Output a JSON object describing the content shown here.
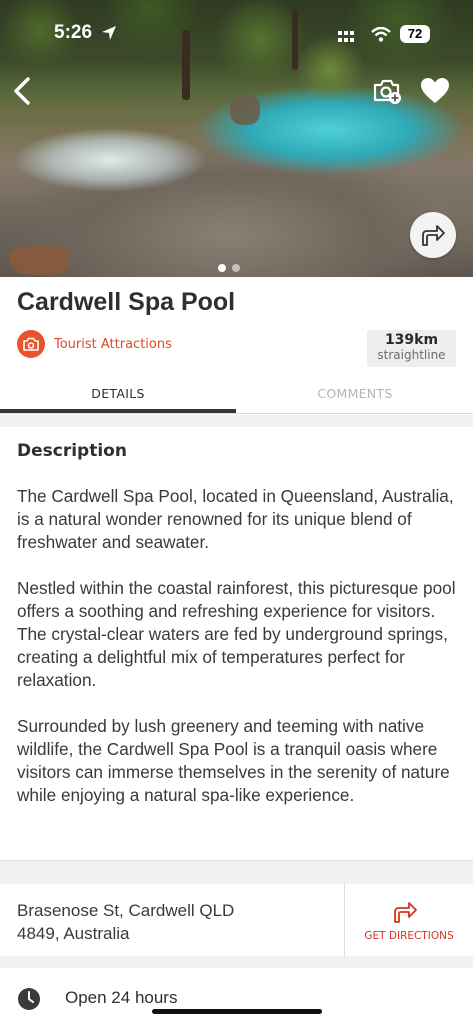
{
  "status_bar": {
    "time": "5:26",
    "battery": "72"
  },
  "place": {
    "name": "Cardwell Spa Pool",
    "category": "Tourist Attractions",
    "distance_value": "139km",
    "distance_label": "straightline"
  },
  "tabs": [
    {
      "label": "DETAILS",
      "active": true
    },
    {
      "label": "COMMENTS",
      "active": false
    }
  ],
  "gallery": {
    "total": 2,
    "current": 1
  },
  "description": {
    "heading": "Description",
    "paragraphs": [
      "The Cardwell Spa Pool, located in Queensland, Australia, is a natural wonder renowned for its unique blend of freshwater and seawater.",
      "Nestled within the coastal rainforest, this picturesque pool offers a soothing and refreshing experience for visitors. The crystal-clear waters are fed by underground springs, creating a delightful mix of temperatures perfect for relaxation.",
      "Surrounded by lush greenery and teeming with native wildlife, the Cardwell Spa Pool is a tranquil oasis where visitors can immerse themselves in the serenity of nature while enjoying a natural spa-like experience."
    ]
  },
  "address": {
    "line1": "Brasenose St, Cardwell QLD",
    "line2": "4849, Australia",
    "directions_label": "GET DIRECTIONS"
  },
  "hours": {
    "label": "Open 24 hours"
  },
  "colors": {
    "accent": "#e8532b",
    "tab_indicator": "#3a3440"
  },
  "icons": [
    "back-arrow-icon",
    "add-photo-icon",
    "heart-icon",
    "share-arrow-icon",
    "camera-icon",
    "directions-arrow-icon",
    "clock-icon"
  ]
}
